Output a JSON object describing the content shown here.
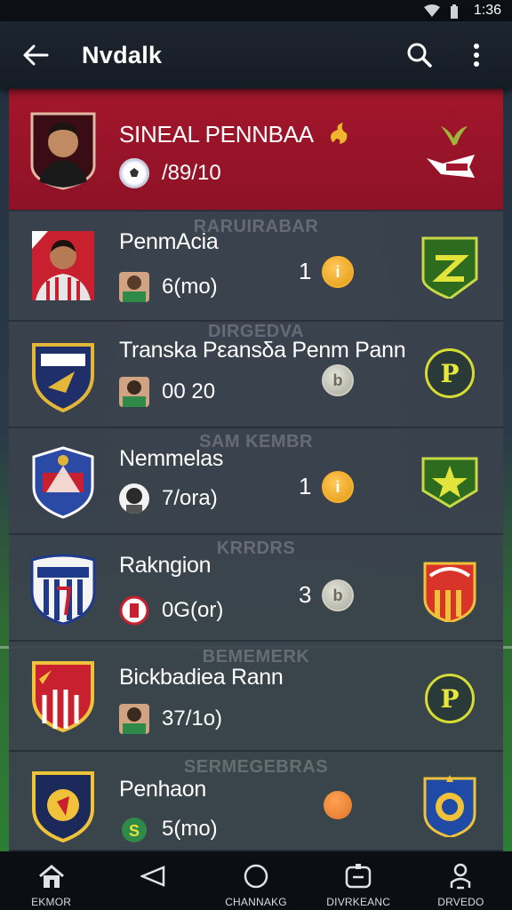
{
  "status_bar": {
    "time": "1:36"
  },
  "app_bar": {
    "title": "Nvdalk"
  },
  "featured": {
    "name": "SINEAL PENNBAA",
    "stat": "/89/10"
  },
  "rows": [
    {
      "name": "PenmAcia",
      "stat": "6(mo)",
      "faint": "RARUIRABAR",
      "rank": "1",
      "coin": "gold",
      "badge": "green-z"
    },
    {
      "name": "Transka Pεansδa Penm Pann",
      "stat": "00 20",
      "faint": "DIRGEDVA",
      "rank": "",
      "coin": "silver",
      "badge": "p"
    },
    {
      "name": "Nemmelas",
      "stat": "7/ora)",
      "faint": "SAM KEMBR",
      "rank": "1",
      "coin": "gold",
      "badge": "green-star"
    },
    {
      "name": "Rakngion",
      "stat": "0G(or)",
      "faint": "KRRDRS",
      "rank": "3",
      "coin": "silver",
      "badge": "red-stripe"
    },
    {
      "name": "Bickbadiea Rann",
      "stat": "37/1o)",
      "faint": "BEMEMERK",
      "rank": "",
      "coin": "",
      "badge": "p"
    },
    {
      "name": "Penhaon",
      "stat": "5(mo)",
      "faint": "SERMEGEBRAS",
      "rank": "",
      "coin": "orange",
      "badge": "blue-crest"
    }
  ],
  "bottom_nav": [
    {
      "label": "EKMOR",
      "icon": "home-icon"
    },
    {
      "label": "",
      "icon": "back-triangle-icon"
    },
    {
      "label": "CHANNAKG",
      "icon": "circle-icon"
    },
    {
      "label": "DIVRKEANC",
      "icon": "square-icon"
    },
    {
      "label": "DRVEDO",
      "icon": "person-icon"
    }
  ],
  "colors": {
    "featured": "#a3162b",
    "card": "#3a424c",
    "gold": "#f2a826",
    "badge_p": "#d7dc33"
  }
}
